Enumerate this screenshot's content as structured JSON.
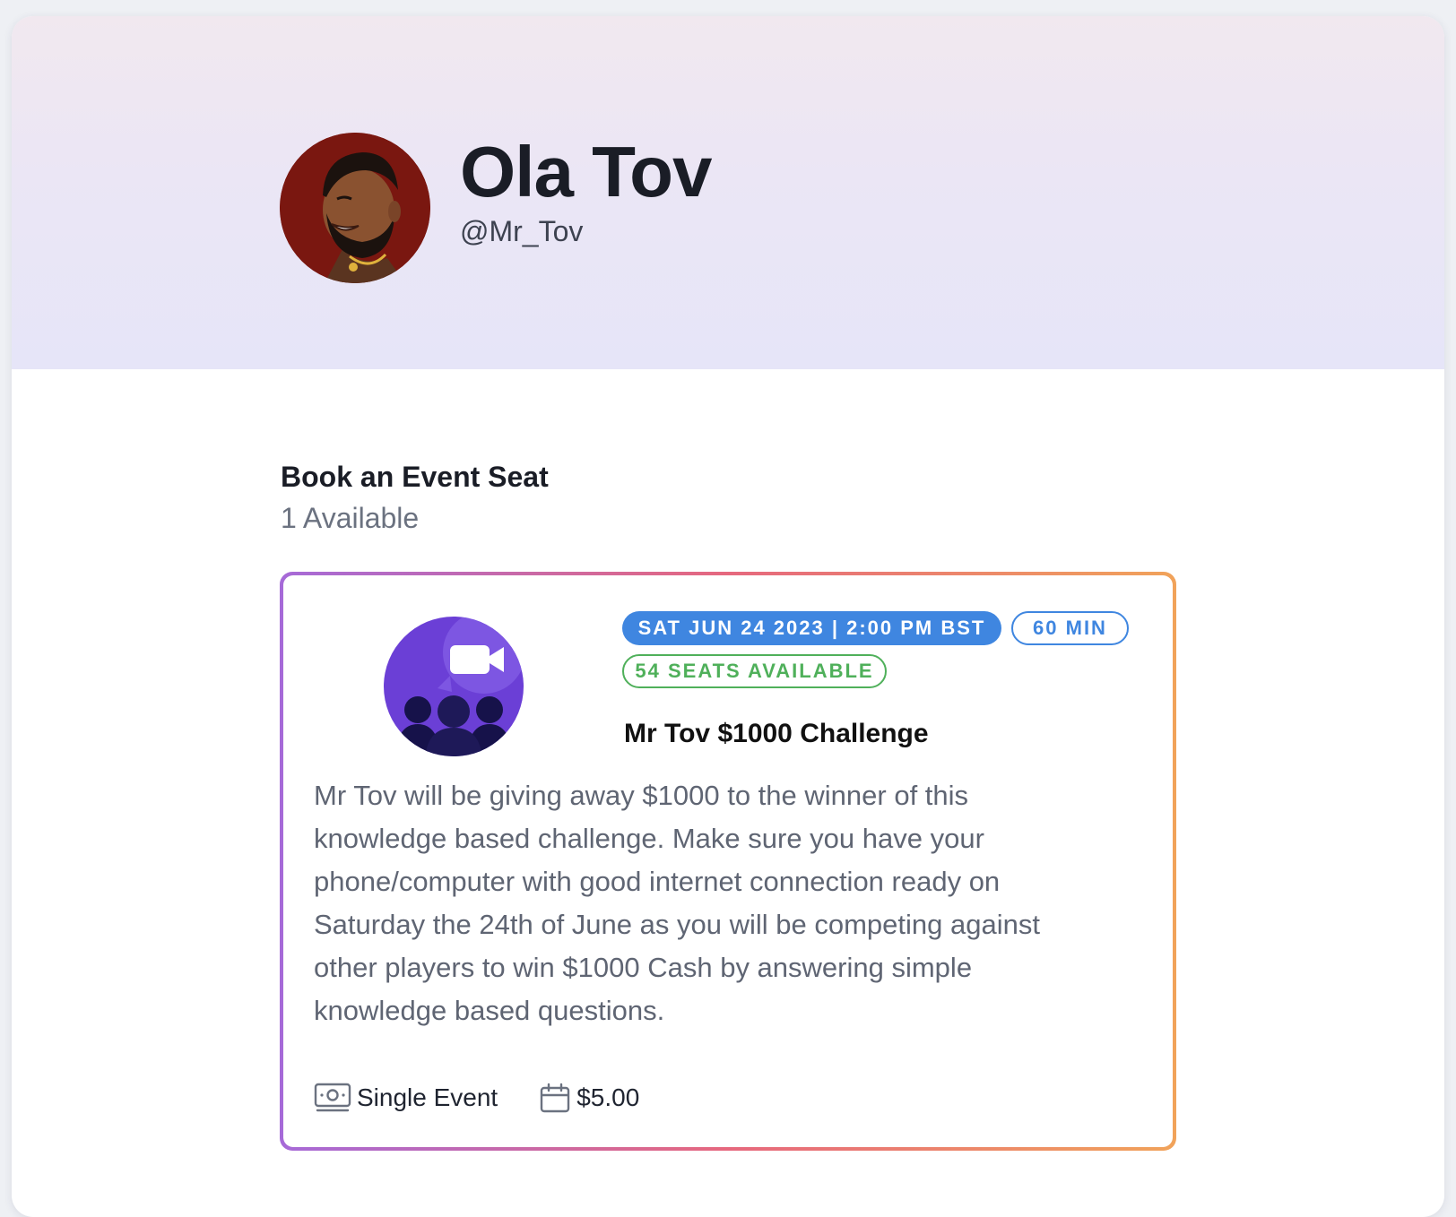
{
  "profile": {
    "name": "Ola Tov",
    "handle": "@Mr_Tov"
  },
  "section": {
    "title": "Book an Event Seat",
    "available": "1 Available"
  },
  "event": {
    "date_badge": "SAT JUN 24 2023 | 2:00 PM BST",
    "duration_badge": "60 MIN",
    "seats_badge": "54 SEATS AVAILABLE",
    "title": "Mr Tov $1000 Challenge",
    "description": "Mr Tov will be giving away $1000 to the winner of this knowledge based challenge. Make sure you have your phone/computer with good internet connection ready on Saturday the 24th of June as you will be competing against other players to win $1000 Cash by answering simple knowledge based questions.",
    "type_label": "Single Event",
    "type_icon": "money-icon",
    "price": "$5.00",
    "price_icon": "calendar-icon"
  },
  "colors": {
    "date_badge": "#3f86e0",
    "seats_badge": "#4fb05a",
    "card_border_start": "#a66ad8",
    "card_border_end": "#f1a35a"
  }
}
